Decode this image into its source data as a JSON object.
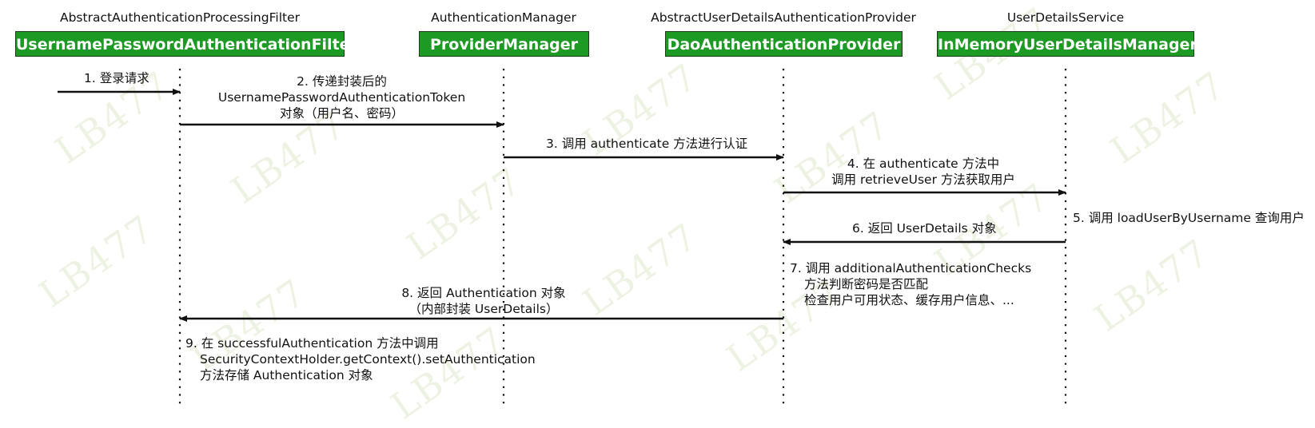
{
  "watermark": "LB477",
  "participants": [
    {
      "super_label": "AbstractAuthenticationProcessingFilter",
      "box_label": "UsernamePasswordAuthenticationFilter"
    },
    {
      "super_label": "AuthenticationManager",
      "box_label": "ProviderManager"
    },
    {
      "super_label": "AbstractUserDetailsAuthenticationProvider",
      "box_label": "DaoAuthenticationProvider"
    },
    {
      "super_label": "UserDetailsService",
      "box_label": "InMemoryUserDetailsManager"
    }
  ],
  "steps": [
    {
      "lines": [
        "1. 登录请求"
      ]
    },
    {
      "lines": [
        "2. 传递封装后的",
        "UsernamePasswordAuthenticationToken",
        "对象（用户名、密码）"
      ]
    },
    {
      "lines": [
        "3. 调用 authenticate 方法进行认证"
      ]
    },
    {
      "lines": [
        "4. 在 authenticate 方法中",
        "调用 retrieveUser 方法获取用户"
      ]
    },
    {
      "lines": [
        "5. 调用 loadUserByUsername 查询用户"
      ]
    },
    {
      "lines": [
        "6. 返回 UserDetails 对象"
      ]
    },
    {
      "lines": [
        "7. 调用 additionalAuthenticationChecks",
        "方法判断密码是否匹配",
        "检查用户可用状态、缓存用户信息、..."
      ]
    },
    {
      "lines": [
        "8. 返回 Authentication 对象",
        "（内部封装 UserDetails）"
      ]
    },
    {
      "lines": [
        "9. 在 successfulAuthentication 方法中调用",
        "SecurityContextHolder.getContext().setAuthentication",
        "方法存储 Authentication 对象"
      ]
    }
  ],
  "colors": {
    "box_fill": "#1d9a23",
    "box_text": "#ffffff",
    "line": "#111111",
    "watermark": "#eef2e2"
  }
}
